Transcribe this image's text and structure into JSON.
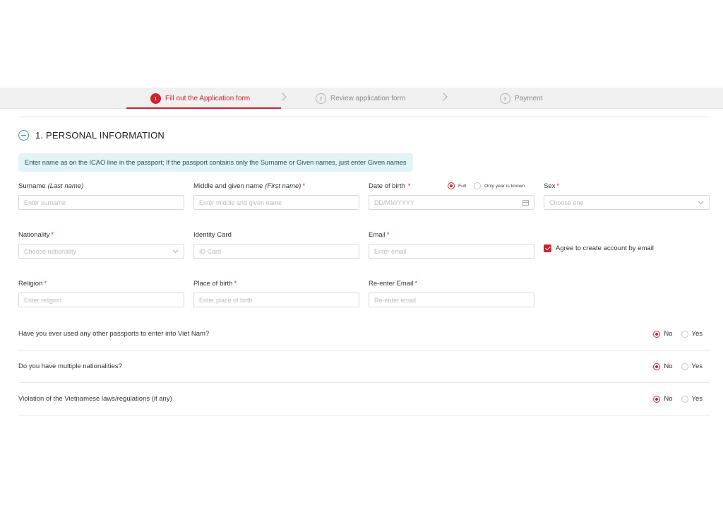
{
  "stepper": {
    "steps": [
      {
        "num": "1",
        "label": "Fill out the Application form",
        "active": true
      },
      {
        "num": "2",
        "label": "Review application form",
        "active": false
      },
      {
        "num": "3",
        "label": "Payment",
        "active": false
      }
    ]
  },
  "section": {
    "title": "1. PERSONAL INFORMATION",
    "info": "Enter name as on the ICAO line in the passport; If the passport contains only the Surname or Given names, just enter Given names"
  },
  "fields": {
    "surname": {
      "label": "Surname",
      "hint": "(Last name)",
      "placeholder": "Enter surname"
    },
    "given": {
      "label": "Middle and given name",
      "hint": "(First name)",
      "required": "*",
      "placeholder": "Enter middle and given name"
    },
    "dob": {
      "label": "Date of birth",
      "required": "*",
      "placeholder": "DD/MM/YYYY",
      "option_full": "Full",
      "option_year": "Only year is known",
      "selected": "Full"
    },
    "sex": {
      "label": "Sex",
      "required": "*",
      "placeholder": "Choose one"
    },
    "nationality": {
      "label": "Nationality",
      "required": "*",
      "placeholder": "Choose nationality"
    },
    "identity": {
      "label": "Identity Card",
      "placeholder": "ID Card"
    },
    "email": {
      "label": "Email",
      "required": "*",
      "placeholder": "Enter email"
    },
    "religion": {
      "label": "Religion",
      "required": "*",
      "placeholder": "Enter religion"
    },
    "birthplace": {
      "label": "Place of birth",
      "required": "*",
      "placeholder": "Enter place of birth"
    },
    "reemail": {
      "label": "Re-enter Email",
      "required": "*",
      "placeholder": "Re-enter email"
    }
  },
  "agree": {
    "label": "Agree to create account by email",
    "checked": true
  },
  "questions": [
    {
      "text": "Have you ever used any other passports to enter into Viet Nam?",
      "no": "No",
      "yes": "Yes",
      "selected": "No"
    },
    {
      "text": "Do you have multiple nationalities?",
      "no": "No",
      "yes": "Yes",
      "selected": "No"
    },
    {
      "text": "Violation of the Vietnamese laws/regulations (if any)",
      "no": "No",
      "yes": "Yes",
      "selected": "No"
    }
  ],
  "colors": {
    "accent": "#d0212f",
    "teal": "#3a9aa6",
    "info_bg": "#e2f4f8",
    "stepper_bg": "#f0f0f0"
  },
  "icons": {
    "collapse": "minus-circle-icon",
    "calendar": "calendar-icon",
    "dropdown": "chevron-down-icon",
    "step_separator": "chevron-right-icon"
  }
}
